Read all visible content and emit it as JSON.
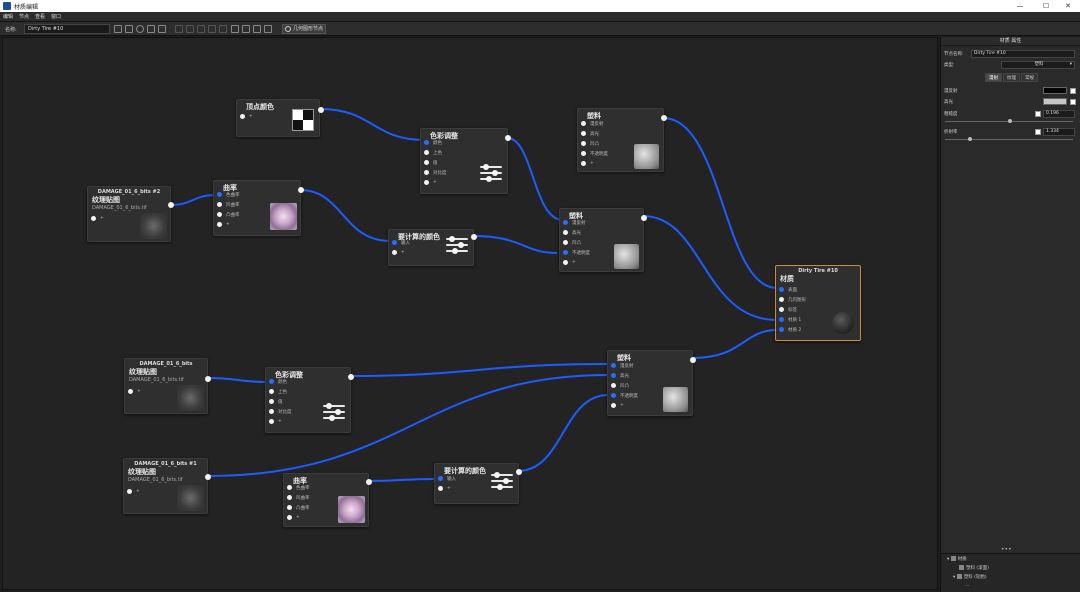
{
  "window": {
    "title": "材质编辑",
    "minimize": "—",
    "maximize": "☐",
    "close": "✕"
  },
  "menu": [
    "编辑",
    "节点",
    "查看",
    "窗口"
  ],
  "toolbar": {
    "name_label": "名称:",
    "name_value": "Dirty Tire  #10",
    "convert_button": "几何图形节点"
  },
  "panel": {
    "title": "材质 属性",
    "node_name_label": "节点名称:",
    "node_name_value": "Dirty Tire  #10",
    "type_label": "类型:",
    "type_value": "塑料",
    "tabs": [
      "漫射",
      "纹理",
      "常规"
    ],
    "props": [
      {
        "label": "漫反射",
        "value": "",
        "color": "#050505"
      },
      {
        "label": "高光",
        "value": "",
        "color": "#c6c6c6"
      },
      {
        "label": "粗糙度",
        "value": "0.196"
      },
      {
        "label": "折射率",
        "value": "1.334"
      }
    ],
    "tree": {
      "dots": "•••",
      "items": [
        "材质",
        "塑料 (漆面)",
        "塑料 (轮胎)",
        "…"
      ]
    }
  },
  "nodes": {
    "vcolor": {
      "title": "顶点颜色",
      "ports": [
        "+"
      ]
    },
    "cc1": {
      "title": "色彩调整",
      "ports": [
        "颜色",
        "上色",
        "值",
        "对比度",
        "+"
      ]
    },
    "plastic_top": {
      "title": "塑料",
      "ports": [
        "漫反射",
        "高光",
        "凹凸",
        "不透明度",
        "+"
      ]
    },
    "tex2": {
      "header": "DAMAGE_01_6_bits #2",
      "title": "纹理贴图",
      "file": "DAMAGE_01_6_bits.tif",
      "ports": [
        "+"
      ]
    },
    "curv1": {
      "title": "曲率",
      "ports": [
        "色曲率",
        "凹曲率",
        "凸曲率",
        "+"
      ]
    },
    "prec1": {
      "title": "要计算的颜色",
      "ports": [
        "输入",
        "+"
      ]
    },
    "plastic_mid": {
      "title": "塑料",
      "ports": [
        "漫反射",
        "高光",
        "凹凸",
        "不透明度",
        "+"
      ]
    },
    "mat": {
      "header": "Dirty Tire  #10",
      "title": "材质",
      "ports": [
        "表面",
        "几何图形",
        "标签",
        "材质 1",
        "材质 2"
      ]
    },
    "tex_plain": {
      "header": "DAMAGE_01_6_bits",
      "title": "纹理贴图",
      "file": "DAMAGE_01_6_bits.tif",
      "ports": [
        "+"
      ]
    },
    "cc2": {
      "title": "色彩调整",
      "ports": [
        "颜色",
        "上色",
        "值",
        "对比度",
        "+"
      ]
    },
    "plastic_low": {
      "title": "塑料",
      "ports": [
        "漫反射",
        "高光",
        "凹凸",
        "不透明度",
        "+"
      ]
    },
    "tex1": {
      "header": "DAMAGE_01_6_bits #1",
      "title": "纹理贴图",
      "file": "DAMAGE_01_6_bits.tif",
      "ports": [
        "+"
      ]
    },
    "curv2": {
      "title": "曲率",
      "ports": [
        "色曲率",
        "凹曲率",
        "凸曲率",
        "+"
      ]
    },
    "prec2": {
      "title": "要计算的颜色",
      "ports": [
        "输入",
        "+"
      ]
    }
  }
}
